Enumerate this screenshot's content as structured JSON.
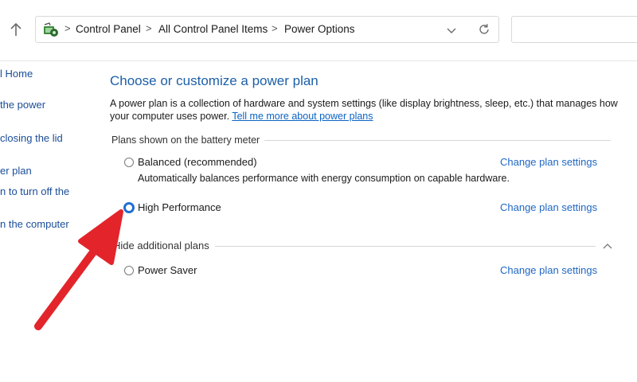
{
  "address_bar": {
    "breadcrumbs": [
      "Control Panel",
      "All Control Panel Items",
      "Power Options"
    ]
  },
  "left_nav": {
    "items": [
      "l Home",
      "the power",
      "closing the lid",
      "er plan",
      "n to turn off the",
      "n the computer"
    ]
  },
  "main": {
    "title": "Choose or customize a power plan",
    "description": "A power plan is a collection of hardware and system settings (like display brightness, sleep, etc.) that manages how your computer uses power.",
    "description_link": "Tell me more about power plans",
    "section_label": "Plans shown on the battery meter",
    "plans": [
      {
        "name": "Balanced (recommended)",
        "description": "Automatically balances performance with energy consumption on capable hardware.",
        "link": "Change plan settings",
        "selected": false
      },
      {
        "name": "High Performance",
        "link": "Change plan settings",
        "selected": true
      }
    ],
    "additional_label": "Hide additional plans",
    "additional_plans": [
      {
        "name": "Power Saver",
        "link": "Change plan settings",
        "selected": false
      }
    ]
  },
  "colors": {
    "title_blue": "#1c5fa8",
    "link_blue": "#1f67c4",
    "arrow_red": "#e3242b",
    "radio_selected": "#1f6fd1"
  }
}
